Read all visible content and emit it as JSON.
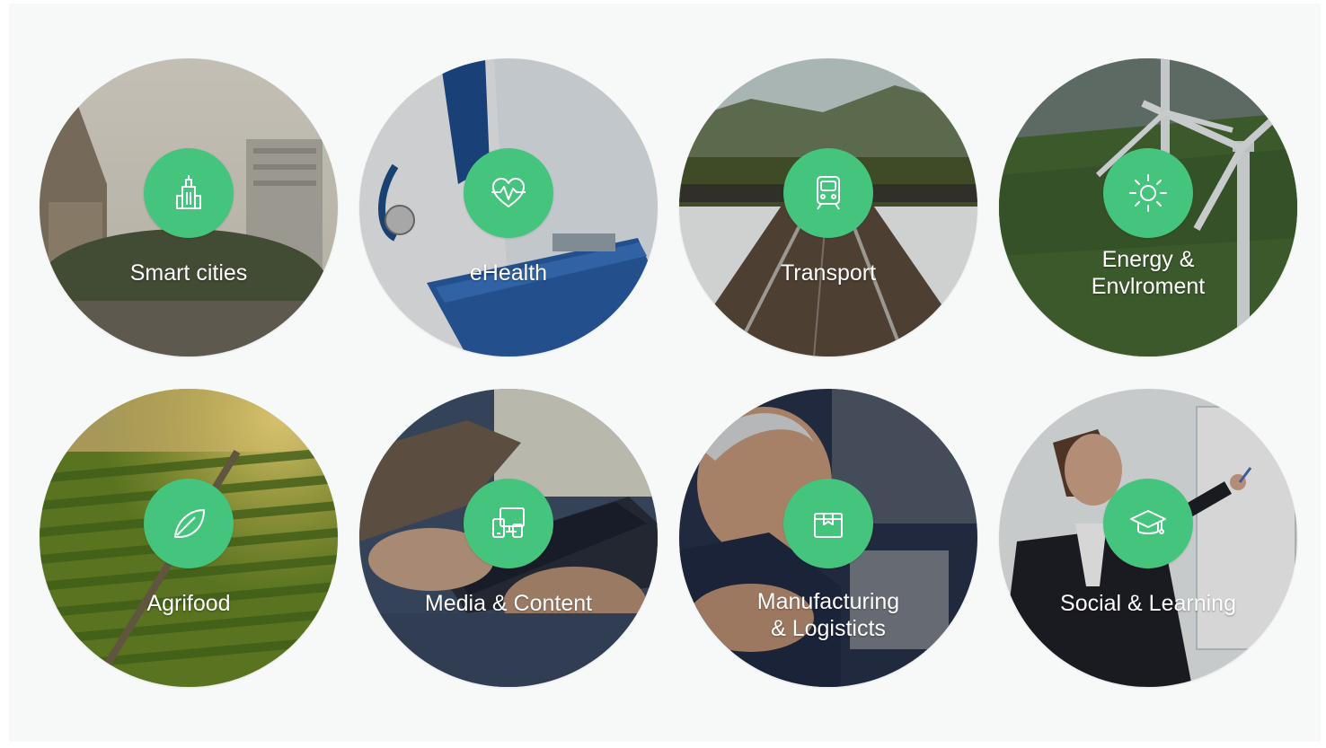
{
  "page": {
    "background": "#f7f8f8",
    "accent": "#45c47d"
  },
  "categories": [
    {
      "id": "smart-cities",
      "label": "Smart cities",
      "icon": "city-buildings-icon"
    },
    {
      "id": "ehealth",
      "label": "eHealth",
      "icon": "heart-pulse-icon"
    },
    {
      "id": "transport",
      "label": "Transport",
      "icon": "train-icon"
    },
    {
      "id": "energy-environment",
      "label_line1": "Energy &",
      "label_line2": "Envlroment",
      "icon": "sun-icon"
    },
    {
      "id": "agrifood",
      "label": "Agrifood",
      "icon": "leaf-icon"
    },
    {
      "id": "media-content",
      "label": "Media & Content",
      "icon": "devices-icon"
    },
    {
      "id": "manufacturing-logistics",
      "label_line1": "Manufacturing",
      "label_line2": "& Logisticts",
      "icon": "package-box-icon"
    },
    {
      "id": "social-learning",
      "label": "Social & Learning",
      "icon": "graduation-cap-icon"
    }
  ]
}
